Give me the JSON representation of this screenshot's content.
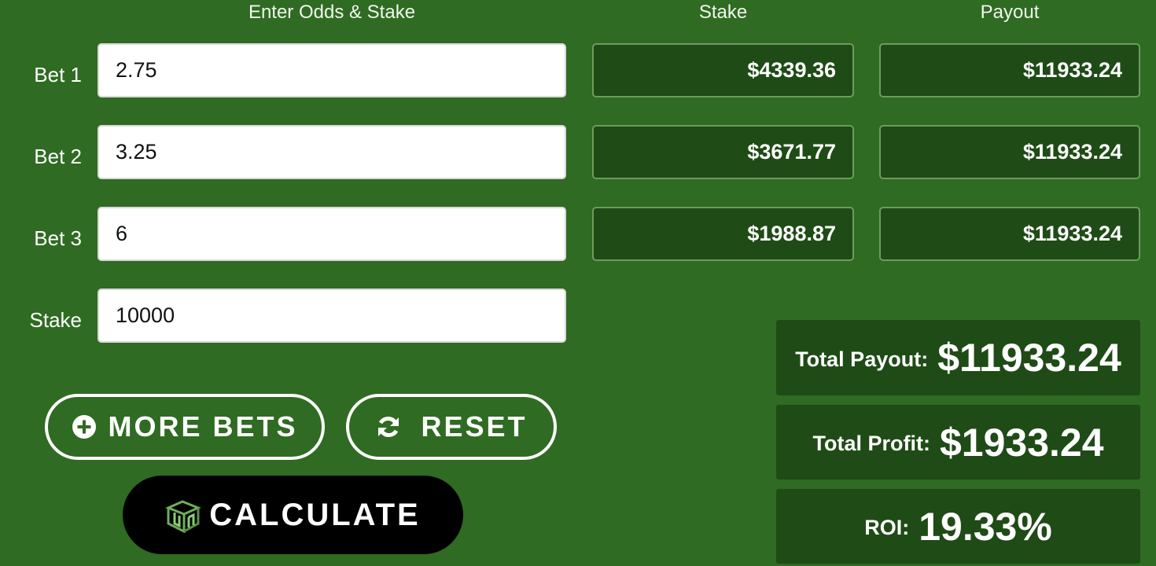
{
  "headers": {
    "odds": "Enter Odds & Stake",
    "stake": "Stake",
    "payout": "Payout"
  },
  "bets": [
    {
      "label": "Bet 1",
      "odds": "2.75",
      "stake": "$4339.36",
      "payout": "$11933.24"
    },
    {
      "label": "Bet 2",
      "odds": "3.25",
      "stake": "$3671.77",
      "payout": "$11933.24"
    },
    {
      "label": "Bet 3",
      "odds": "6",
      "stake": "$1988.87",
      "payout": "$11933.24"
    }
  ],
  "total_stake": {
    "label": "Stake",
    "value": "10000"
  },
  "buttons": {
    "more_bets": "MORE BETS",
    "reset": "RESET",
    "calculate": "CALCULATE"
  },
  "summary": {
    "total_payout_label": "Total Payout:",
    "total_payout_value": "$11933.24",
    "total_profit_label": "Total Profit:",
    "total_profit_value": "$1933.24",
    "roi_label": "ROI:",
    "roi_value": "19.33%"
  },
  "colors": {
    "background": "#2f6b22",
    "output_box": "#1f4b16",
    "output_border": "#6c9d5b",
    "calculate_button": "#000000"
  },
  "icons": {
    "more_bets": "plus-circle-icon",
    "reset": "refresh-icon",
    "calculate": "brand-logo-icon"
  }
}
